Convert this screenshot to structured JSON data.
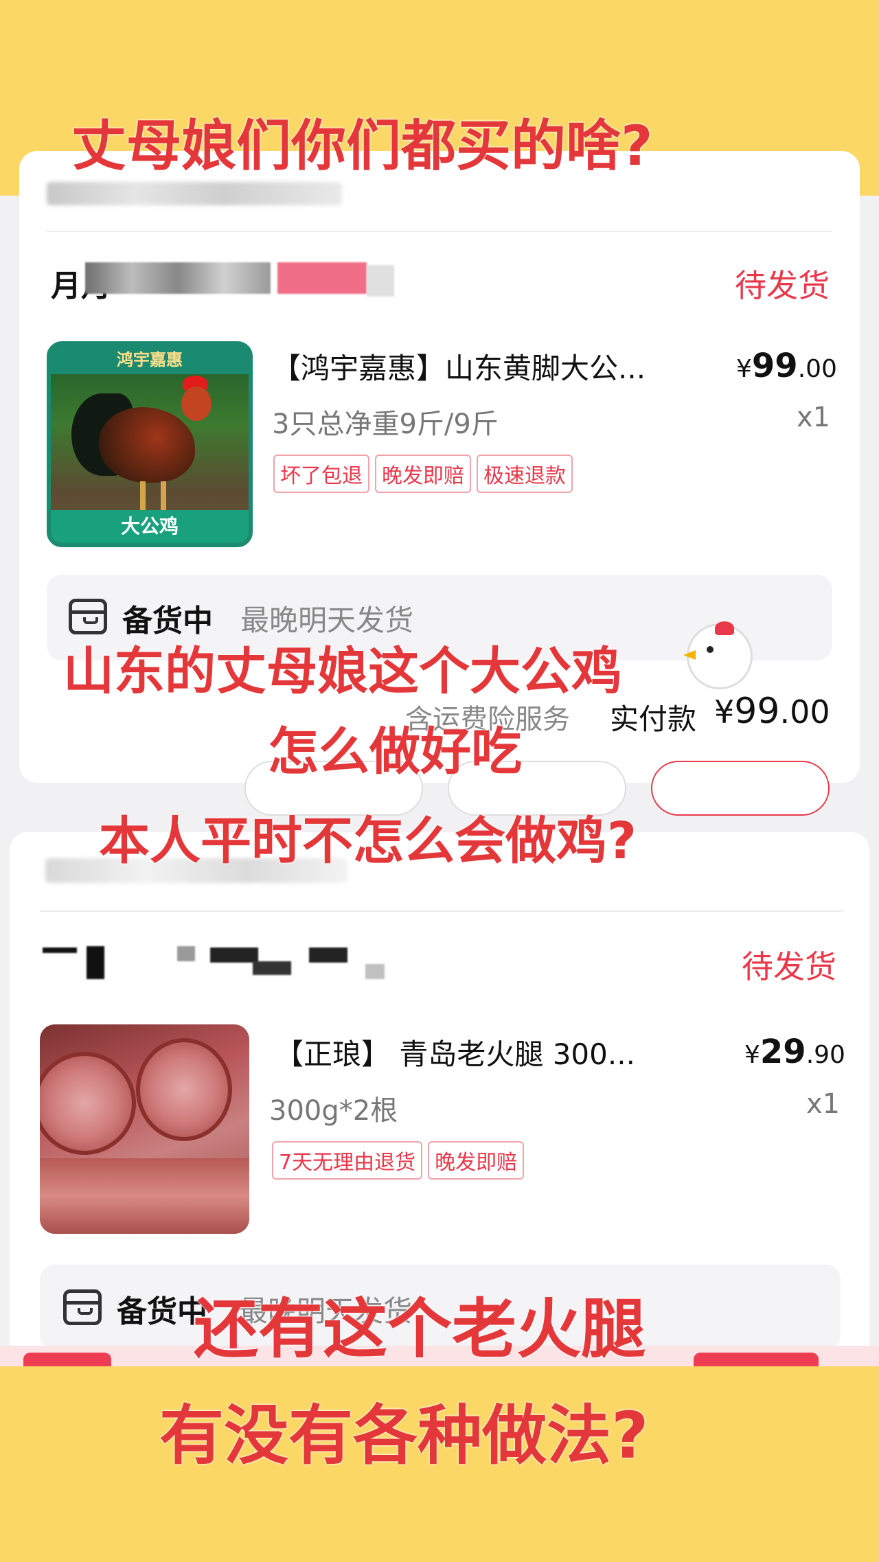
{
  "captions": {
    "top": "丈母娘们你们都买的啥?",
    "mid_line1": "山东的丈母娘这个大公鸡",
    "mid_line2": "怎么做好吃",
    "mid_line3": "本人平时不怎么会做鸡?",
    "bottom_line1": "还有这个老火腿",
    "bottom_line2": "有没有各种做法?"
  },
  "icons": {
    "chicken": "chicken-emoji-icon",
    "shipping": "package-box-icon"
  },
  "colors": {
    "banner": "#fbd766",
    "accent_red": "#e8384a",
    "caption_red": "#e3373a"
  },
  "orders": [
    {
      "shop_name": "月月",
      "status": "待发货",
      "product_tag_top": "鸿宇嘉惠",
      "product_tag_bottom": "大公鸡",
      "title": "【鸿宇嘉惠】山东黄脚大公...",
      "price_symbol": "¥",
      "price_int": "99",
      "price_dec": ".00",
      "spec": "3只总净重9斤/9斤",
      "qty": "x1",
      "badges": [
        "坏了包退",
        "晚发即赔",
        "极速退款"
      ],
      "shipping_status": "备货中",
      "shipping_note": "最晚明天发货",
      "service": "含运费险服务",
      "paid_label": "实付款",
      "paid_symbol": "¥",
      "paid_int": "99",
      "paid_dec": ".00"
    },
    {
      "shop_name": "",
      "status": "待发货",
      "title": "【正琅】 青岛老火腿 300...",
      "price_symbol": "¥",
      "price_int": "29",
      "price_dec": ".90",
      "spec": "300g*2根",
      "qty": "x1",
      "badges": [
        "7天无理由退货",
        "晚发即赔"
      ],
      "shipping_status": "备货中",
      "shipping_note": "最晚明天发货"
    }
  ]
}
